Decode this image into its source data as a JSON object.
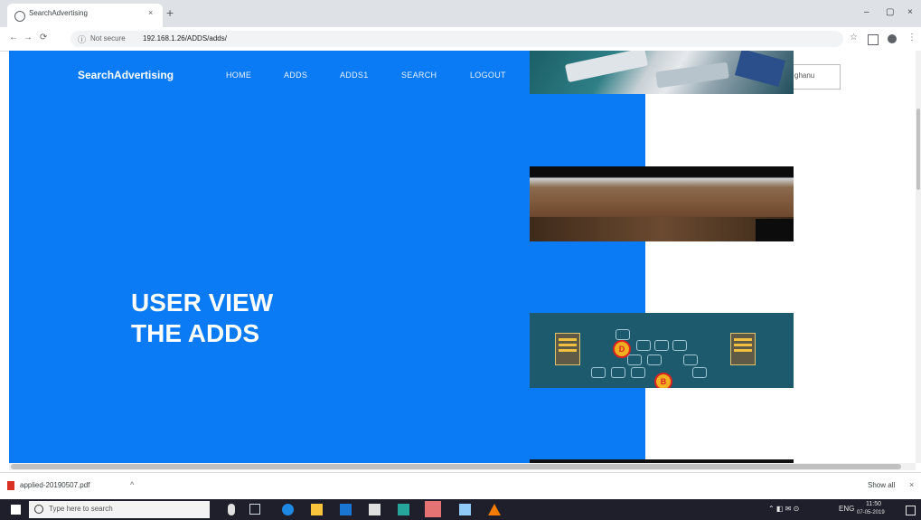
{
  "browser": {
    "tab_title": "SearchAdvertising",
    "tab_close": "×",
    "new_tab": "+",
    "window_controls": {
      "minimize": "–",
      "maximize": "▢",
      "close": "×"
    },
    "nav": {
      "back": "←",
      "forward": "→",
      "reload": "⟳"
    },
    "omnibox": {
      "info": "ⓘ",
      "security_label": "Not secure",
      "url": "192.168.1.26/ADDS/adds/"
    },
    "toolbar_icons": {
      "star": "☆",
      "menu": "⋮"
    }
  },
  "page": {
    "brand": "SearchAdvertising",
    "nav": [
      {
        "label": "HOME"
      },
      {
        "label": "ADDS"
      },
      {
        "label": "ADDS1"
      },
      {
        "label": "SEARCH"
      },
      {
        "label": "LOGOUT"
      }
    ],
    "hero": {
      "line1": "USER VIEW",
      "line2": "THE ADDS"
    },
    "user_box": "ghanu",
    "ad_nodes": {
      "d": "D",
      "b": "B"
    }
  },
  "download_shelf": {
    "file_name": "applied-20190507.pdf",
    "chevron": "^",
    "show_all": "Show all",
    "close": "×"
  },
  "taskbar": {
    "search_placeholder": "Type here to search",
    "tray": {
      "time": "11:50",
      "date": "07-05-2019",
      "lang": "ENG"
    }
  },
  "colors": {
    "hero_blue": "#0a7bf4",
    "taskbar": "#1f1f2b"
  }
}
